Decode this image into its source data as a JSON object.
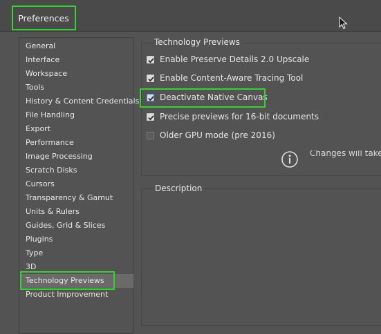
{
  "window": {
    "title": "Preferences"
  },
  "sidebar": {
    "items": [
      {
        "label": "General"
      },
      {
        "label": "Interface"
      },
      {
        "label": "Workspace"
      },
      {
        "label": "Tools"
      },
      {
        "label": "History & Content Credentials"
      },
      {
        "label": "File Handling"
      },
      {
        "label": "Export"
      },
      {
        "label": "Performance"
      },
      {
        "label": "Image Processing"
      },
      {
        "label": "Scratch Disks"
      },
      {
        "label": "Cursors"
      },
      {
        "label": "Transparency & Gamut"
      },
      {
        "label": "Units & Rulers"
      },
      {
        "label": "Guides, Grid & Slices"
      },
      {
        "label": "Plugins"
      },
      {
        "label": "Type"
      },
      {
        "label": "3D"
      },
      {
        "label": "Technology Previews"
      },
      {
        "label": "Product Improvement"
      }
    ],
    "selected": "Technology Previews"
  },
  "technology_previews": {
    "group_title": "Technology Previews",
    "options": [
      {
        "label": "Enable Preserve Details 2.0 Upscale",
        "checked": true
      },
      {
        "label": "Enable Content-Aware Tracing Tool",
        "checked": true
      },
      {
        "label": "Deactivate Native Canvas",
        "checked": true
      },
      {
        "label": "Precise previews for 16-bit documents",
        "checked": true
      },
      {
        "label": "Older GPU mode (pre 2016)",
        "checked": false
      }
    ],
    "info_icon": "info-circle-icon",
    "info_text": "Changes will take e"
  },
  "description": {
    "group_title": "Description"
  },
  "colors": {
    "highlight": "#31d62b",
    "background": "#535353",
    "selected_item": "#6a6a6a"
  }
}
